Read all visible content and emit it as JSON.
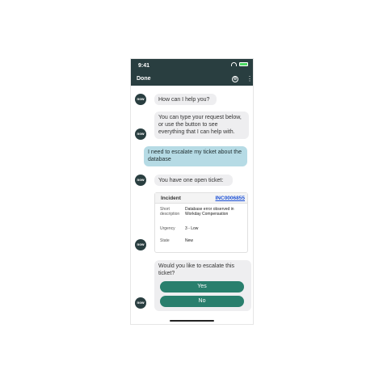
{
  "status_bar": {
    "time": "9:41"
  },
  "nav": {
    "done_label": "Done",
    "compose_glyph": "⊕",
    "more_glyph": "⋮"
  },
  "avatar_label": "now",
  "messages": {
    "greeting": "How can I help you?",
    "intro": "You can type your request below, or use the button to see everything that I can help with.",
    "user_request": "I need to escalate my ticket about the database",
    "open_ticket": "You have one open ticket:",
    "escalate_question": "Would you like to escalate this ticket?"
  },
  "ticket": {
    "header_label": "Incident",
    "number": "INC0006855",
    "fields": [
      {
        "label": "Short description",
        "value": "Database error observed in Workday Compensation"
      },
      {
        "label": "Urgency",
        "value": "3 - Low"
      },
      {
        "label": "State",
        "value": "New"
      }
    ]
  },
  "choices": {
    "yes_label": "Yes",
    "no_label": "No"
  },
  "colors": {
    "header_bg": "#293e40",
    "user_bubble": "#b6dbe5",
    "bot_bubble": "#eeeef0",
    "button_bg": "#297f6d",
    "link": "#1a4fd6"
  }
}
